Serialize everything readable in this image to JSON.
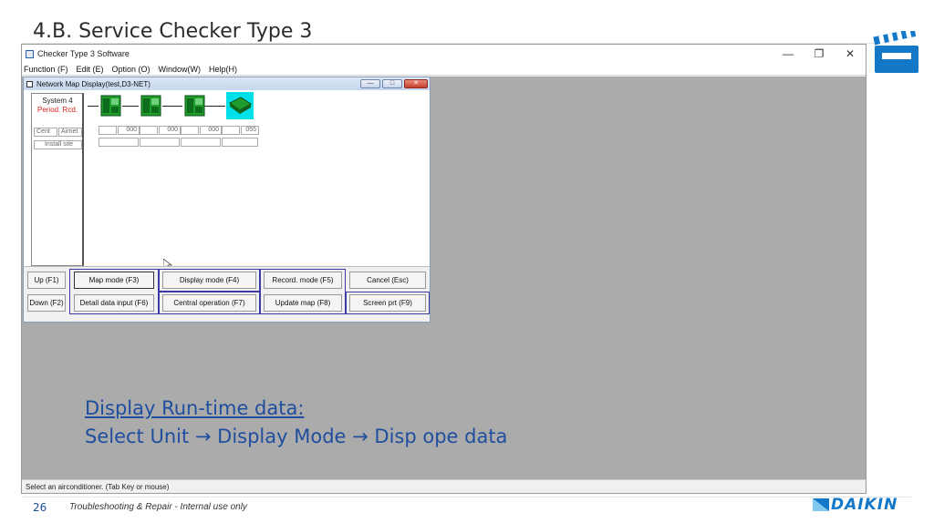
{
  "slide": {
    "title": "4.B. Service Checker Type 3",
    "page_number": "26",
    "footer": "Troubleshooting & Repair - Internal use only",
    "logo": "DAIKIN",
    "note_line1": "Display Run-time data:",
    "note_line2": "Select Unit → Display Mode → Disp ope data"
  },
  "app": {
    "title": "Checker Type 3 Software",
    "controls": {
      "minimize": "—",
      "restore": "❐",
      "close": "✕"
    },
    "menu": [
      "Function (F)",
      "Edit (E)",
      "Option (O)",
      "Window(W)",
      "Help(H)"
    ],
    "status": "Select an airconditioner. (Tab Key or mouse)"
  },
  "child": {
    "title": "Network Map Display(test,D3-NET)",
    "system_label": "System 4",
    "period_label": "Period. Rcd.",
    "cent_label": "Cent",
    "airnet_label": "Airnet",
    "install_label": "Install site",
    "addresses": [
      "000",
      "000",
      "000",
      "055"
    ]
  },
  "buttons": {
    "up": "Up (F1)",
    "down": "Down (F2)",
    "map_mode": "Map mode (F3)",
    "display_mode": "Display mode (F4)",
    "record_mode": "Record. mode (F5)",
    "cancel": "Cancel (Esc)",
    "detail_input": "Detail data input (F6)",
    "central_op": "Central operation (F7)",
    "update_map": "Update map (F8)",
    "screen_prt": "Screen prt (F9)"
  },
  "colors": {
    "accent": "#1f4e9e",
    "unit_green": "#1f9e2e",
    "unit_selected_bg": "#00e0e8",
    "group_border": "#3a3aa0",
    "mdi_bg": "#ababab"
  }
}
